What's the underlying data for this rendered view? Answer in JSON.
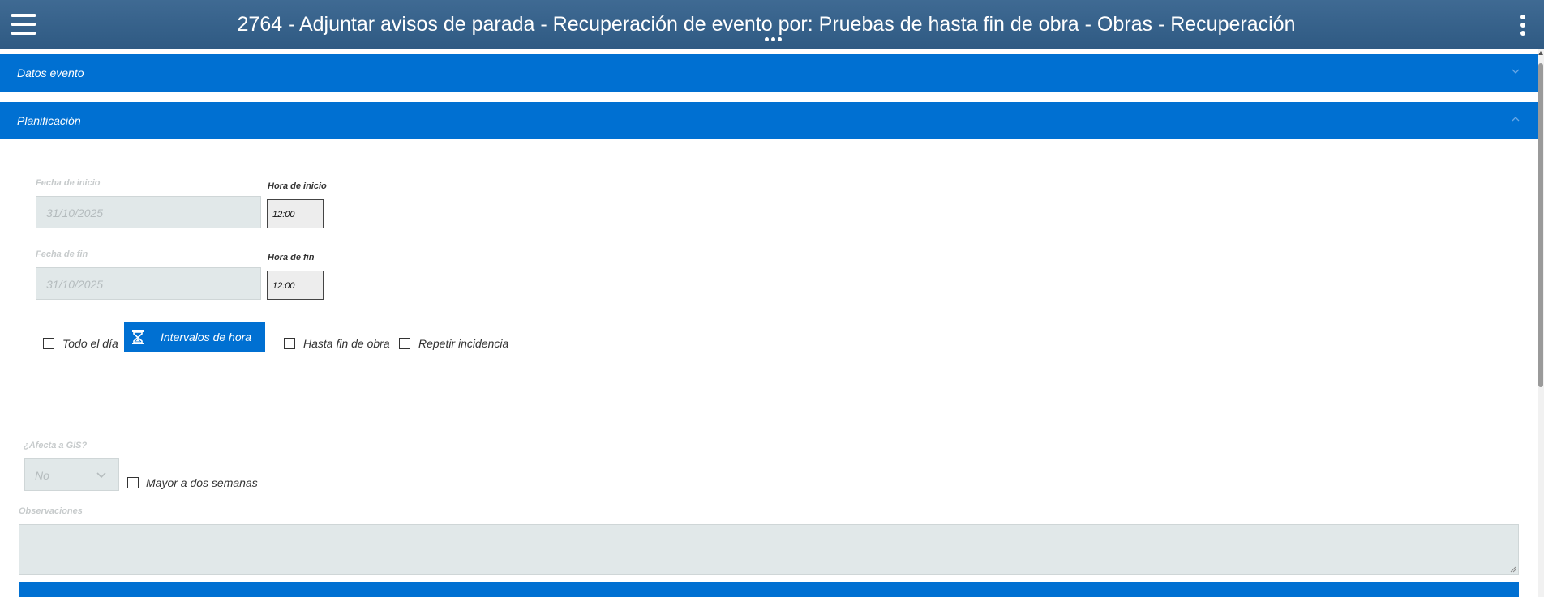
{
  "header": {
    "title": "2764 - Adjuntar avisos de parada - Recuperación de evento por: Pruebas de hasta fin de obra - Obras - Recuperación"
  },
  "sections": {
    "datos_evento": {
      "label": "Datos evento",
      "expanded": false
    },
    "planificacion": {
      "label": "Planificación",
      "expanded": true
    }
  },
  "planificacion": {
    "fecha_inicio": {
      "label": "Fecha de inicio",
      "value": "31/10/2025"
    },
    "hora_inicio": {
      "label": "Hora de inicio",
      "value": "12:00"
    },
    "fecha_fin": {
      "label": "Fecha de fin",
      "value": "31/10/2025"
    },
    "hora_fin": {
      "label": "Hora de fin",
      "value": "12:00"
    },
    "todo_el_dia": {
      "label": "Todo el día",
      "checked": false
    },
    "intervalos_button": {
      "label": "Intervalos de hora"
    },
    "hasta_fin_obra": {
      "label": "Hasta fin de obra",
      "checked": false
    },
    "repetir_incidencia": {
      "label": "Repetir incidencia",
      "checked": false
    },
    "afecta_gis": {
      "label": "¿Afecta a GIS?",
      "value": "No"
    },
    "mayor_dos_semanas": {
      "label": "Mayor a dos semanas",
      "checked": false
    },
    "observaciones": {
      "label": "Observaciones",
      "value": ""
    }
  },
  "colors": {
    "header": "#2f5a83",
    "section_bar": "#0070d2",
    "disabled_input": "#e1e8e9"
  },
  "icons": {
    "menu": "hamburger-icon",
    "more": "kebab-icon",
    "intervals": "hourglass-icon"
  }
}
